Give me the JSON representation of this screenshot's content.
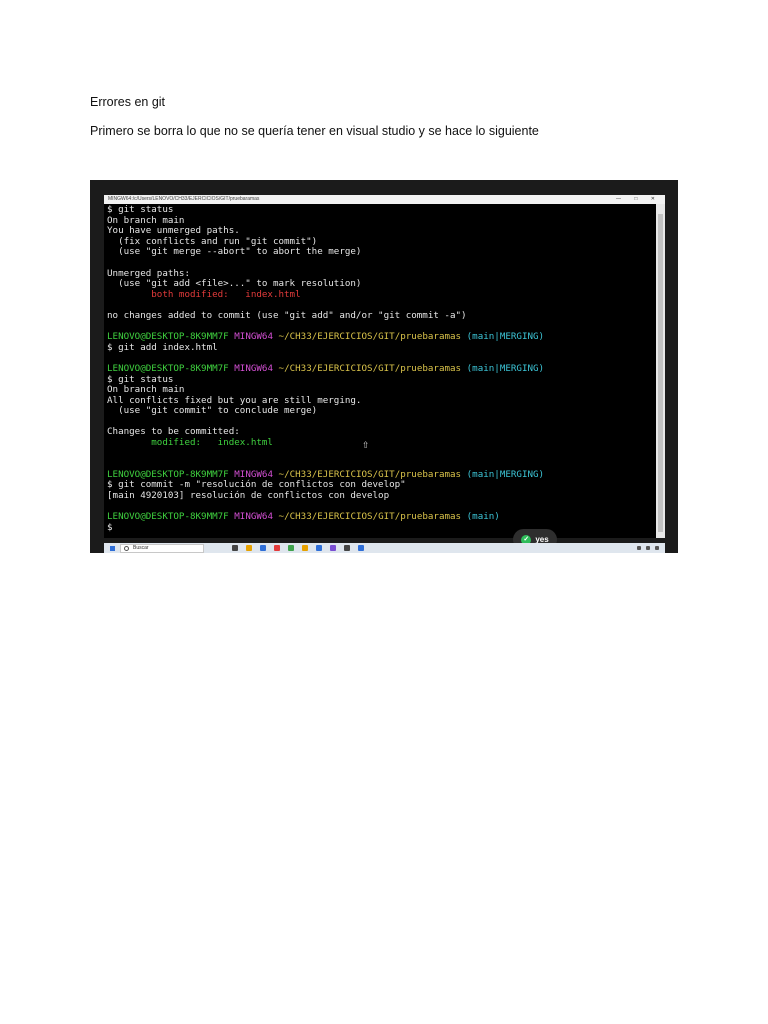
{
  "document": {
    "heading": "Errores en git",
    "paragraph": "Primero se borra lo que no se quería tener en visual studio y se hace lo siguiente"
  },
  "screenshot": {
    "window_title": "MINGW64:/c/Users/LENOVO/CH33/EJERCICIOS/GIT/pruebaramas",
    "window_controls": "— □ ✕",
    "console_lines": [
      [
        {
          "t": "$ git status"
        }
      ],
      [
        {
          "t": "On branch main"
        }
      ],
      [
        {
          "t": "You have unmerged paths."
        }
      ],
      [
        {
          "t": "  (fix conflicts and run \"git commit\")"
        }
      ],
      [
        {
          "t": "  (use \"git merge --abort\" to abort the merge)"
        }
      ],
      [
        {
          "t": ""
        }
      ],
      [
        {
          "t": "Unmerged paths:"
        }
      ],
      [
        {
          "t": "  (use \"git add <file>...\" to mark resolution)"
        }
      ],
      [
        {
          "t": "        both modified:   index.html",
          "c": "red"
        }
      ],
      [
        {
          "t": ""
        }
      ],
      [
        {
          "t": "no changes added to commit (use \"git add\" and/or \"git commit -a\")"
        }
      ],
      [
        {
          "t": ""
        }
      ],
      [
        {
          "t": "LENOVO@DESKTOP-8K9MM7F",
          "c": "green"
        },
        {
          "t": " "
        },
        {
          "t": "MINGW64",
          "c": "magenta"
        },
        {
          "t": " "
        },
        {
          "t": "~/CH33/EJERCICIOS/GIT/pruebaramas",
          "c": "yellow"
        },
        {
          "t": " "
        },
        {
          "t": "(main|MERGING)",
          "c": "cyan"
        }
      ],
      [
        {
          "t": "$ git add index.html"
        }
      ],
      [
        {
          "t": ""
        }
      ],
      [
        {
          "t": "LENOVO@DESKTOP-8K9MM7F",
          "c": "green"
        },
        {
          "t": " "
        },
        {
          "t": "MINGW64",
          "c": "magenta"
        },
        {
          "t": " "
        },
        {
          "t": "~/CH33/EJERCICIOS/GIT/pruebaramas",
          "c": "yellow"
        },
        {
          "t": " "
        },
        {
          "t": "(main|MERGING)",
          "c": "cyan"
        }
      ],
      [
        {
          "t": "$ git status"
        }
      ],
      [
        {
          "t": "On branch main"
        }
      ],
      [
        {
          "t": "All conflicts fixed but you are still merging."
        }
      ],
      [
        {
          "t": "  (use \"git commit\" to conclude merge)"
        }
      ],
      [
        {
          "t": ""
        }
      ],
      [
        {
          "t": "Changes to be committed:"
        }
      ],
      [
        {
          "t": "        modified:   index.html",
          "c": "green"
        }
      ],
      [
        {
          "t": ""
        }
      ],
      [
        {
          "t": ""
        }
      ],
      [
        {
          "t": "LENOVO@DESKTOP-8K9MM7F",
          "c": "green"
        },
        {
          "t": " "
        },
        {
          "t": "MINGW64",
          "c": "magenta"
        },
        {
          "t": " "
        },
        {
          "t": "~/CH33/EJERCICIOS/GIT/pruebaramas",
          "c": "yellow"
        },
        {
          "t": " "
        },
        {
          "t": "(main|MERGING)",
          "c": "cyan"
        }
      ],
      [
        {
          "t": "$ git commit -m \"resolución de conflictos con develop\""
        }
      ],
      [
        {
          "t": "[main 4920103] resolución de conflictos con develop"
        }
      ],
      [
        {
          "t": ""
        }
      ],
      [
        {
          "t": "LENOVO@DESKTOP-8K9MM7F",
          "c": "green"
        },
        {
          "t": " "
        },
        {
          "t": "MINGW64",
          "c": "magenta"
        },
        {
          "t": " "
        },
        {
          "t": "~/CH33/EJERCICIOS/GIT/pruebaramas",
          "c": "yellow"
        },
        {
          "t": " "
        },
        {
          "t": "(main)",
          "c": "cyan"
        }
      ],
      [
        {
          "t": "$"
        }
      ]
    ],
    "toast_label": "yes",
    "taskbar_search_placeholder": "Buscar",
    "taskbar_app_colors": [
      "#444444",
      "#e6a100",
      "#2f6fd8",
      "#e33b3b",
      "#3fa34d",
      "#e6a100",
      "#2f6fd8",
      "#7a4fd3",
      "#444444",
      "#2f6fd8"
    ]
  }
}
